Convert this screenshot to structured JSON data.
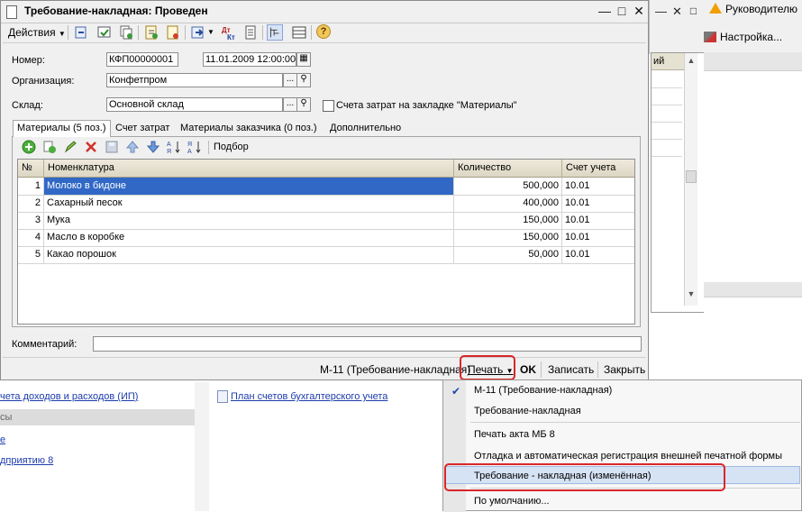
{
  "window": {
    "title": "Требование-накладная: Проведен"
  },
  "toolbar": {
    "actions_label": "Действия",
    "help_symbol": "?"
  },
  "form": {
    "number_label": "Номер:",
    "number_value": "КФП00000001",
    "date_value": "11.01.2009 12:00:00",
    "org_label": "Организация:",
    "org_value": "Конфетпром",
    "warehouse_label": "Склад:",
    "warehouse_value": "Основной склад",
    "cost_accounts_checkbox_label": "Счета затрат на закладке \"Материалы\"",
    "comment_label": "Комментарий:",
    "comment_value": ""
  },
  "tabs": [
    {
      "label": "Материалы (5 поз.)",
      "active": true
    },
    {
      "label": "Счет затрат",
      "active": false
    },
    {
      "label": "Материалы заказчика (0 поз.)",
      "active": false
    },
    {
      "label": "Дополнительно",
      "active": false
    }
  ],
  "tab_toolbar": {
    "selection_label": "Подбор"
  },
  "grid": {
    "columns": [
      "№",
      "Номенклатура",
      "Количество",
      "Счет учета"
    ],
    "rows": [
      {
        "n": "1",
        "item": "Молоко в бидоне",
        "qty": "500,000",
        "account": "10.01"
      },
      {
        "n": "2",
        "item": "Сахарный песок",
        "qty": "400,000",
        "account": "10.01"
      },
      {
        "n": "3",
        "item": "Мука",
        "qty": "150,000",
        "account": "10.01"
      },
      {
        "n": "4",
        "item": "Масло в коробке",
        "qty": "150,000",
        "account": "10.01"
      },
      {
        "n": "5",
        "item": "Какао порошок",
        "qty": "50,000",
        "account": "10.01"
      }
    ]
  },
  "footer": {
    "print_form_label": "М-11 (Требование-накладная)",
    "print_label": "Печать",
    "ok_label": "OK",
    "save_label": "Записать",
    "close_label": "Закрыть"
  },
  "print_menu": {
    "items": [
      "М-11 (Требование-накладная)",
      "Требование-накладная",
      "Печать акта МБ 8",
      "Отладка и автоматическая регистрация внешней печатной формы",
      "Требование - накладная (изменённая)",
      "По умолчанию..."
    ]
  },
  "background": {
    "warning_label": "Руководителю",
    "settings_label": "Настройка...",
    "list_header": "ий",
    "link_income": "чета доходов и расходов (ИП)",
    "link_chart": "План счетов бухгалтерского учета",
    "band_label": "сы",
    "link_e": "е",
    "link_enterprise": "дприятию 8"
  },
  "colors": {
    "selection": "#3168c6",
    "highlight_red": "#d9262a",
    "link": "#1c3cac"
  }
}
